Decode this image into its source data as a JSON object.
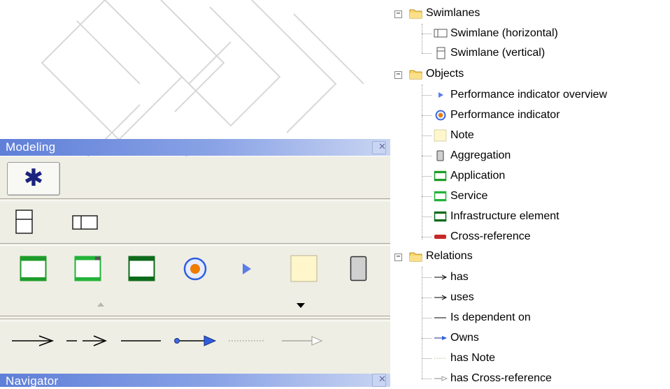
{
  "modeling": {
    "title": "Modeling",
    "close_glyph": "✕",
    "select_glyph": "✱"
  },
  "navigator": {
    "title": "Navigator",
    "close_glyph": "✕"
  },
  "tree": {
    "swimlanes": {
      "label": "Swimlanes",
      "expander": "−",
      "items": [
        {
          "label": "Swimlane (horizontal)",
          "icon": "swimlane-horizontal-icon"
        },
        {
          "label": "Swimlane (vertical)",
          "icon": "swimlane-vertical-icon"
        }
      ]
    },
    "objects": {
      "label": "Objects",
      "expander": "−",
      "items": [
        {
          "label": "Performance indicator overview",
          "icon": "performance-indicator-overview-icon"
        },
        {
          "label": "Performance indicator",
          "icon": "performance-indicator-icon"
        },
        {
          "label": "Note",
          "icon": "note-icon"
        },
        {
          "label": "Aggregation",
          "icon": "aggregation-icon"
        },
        {
          "label": "Application",
          "icon": "application-icon"
        },
        {
          "label": "Service",
          "icon": "service-icon"
        },
        {
          "label": "Infrastructure element",
          "icon": "infrastructure-element-icon"
        },
        {
          "label": "Cross-reference",
          "icon": "cross-reference-icon"
        }
      ]
    },
    "relations": {
      "label": "Relations",
      "expander": "−",
      "items": [
        {
          "label": "has",
          "icon": "has-arrow-icon"
        },
        {
          "label": "uses",
          "icon": "uses-arrow-icon"
        },
        {
          "label": "Is dependent on",
          "icon": "dependent-line-icon"
        },
        {
          "label": "Owns",
          "icon": "owns-arrow-icon"
        },
        {
          "label": "has Note",
          "icon": "has-note-line-icon"
        },
        {
          "label": "has Cross-reference",
          "icon": "has-cross-reference-arrow-icon"
        }
      ]
    }
  },
  "colors": {
    "titlebar_start": "#5f7fd8",
    "palette_bg": "#efeee4",
    "app_green": "#1e9c2a",
    "indicator_orange": "#f07c00",
    "indicator_blue": "#2d5fe0",
    "note_yellow": "#fff6cc",
    "crossref_red": "#c62828"
  }
}
